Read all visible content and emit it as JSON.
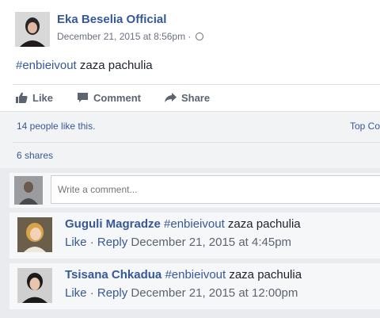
{
  "post": {
    "author": "Eka Beselia Official",
    "timestamp": "December 21, 2015 at 8:56pm · ",
    "hashtag": "#enbieivout",
    "text": " zaza pachulia",
    "actions": {
      "like": "Like",
      "comment": "Comment",
      "share": "Share"
    },
    "likes_summary": "14 people like this.",
    "top_comments": "Top Co",
    "shares": "6 shares"
  },
  "composer": {
    "placeholder": "Write a comment..."
  },
  "comments": [
    {
      "author": "Guguli Magradze",
      "hashtag": "#enbieivout",
      "text": " zaza pachulia",
      "like": "Like",
      "sep": " · ",
      "reply": "Reply",
      "timestamp": "December 21, 2015 at 4:45pm"
    },
    {
      "author": "Tsisana Chkadua",
      "hashtag": "#enbieivout",
      "text": " zaza pachulia",
      "like": "Like",
      "sep": " · ",
      "reply": "Reply",
      "timestamp": "December 21, 2015 at 12:00pm"
    }
  ],
  "colors": {
    "link": "#365899",
    "muted": "#5b6470",
    "background": "#e9ebee"
  }
}
